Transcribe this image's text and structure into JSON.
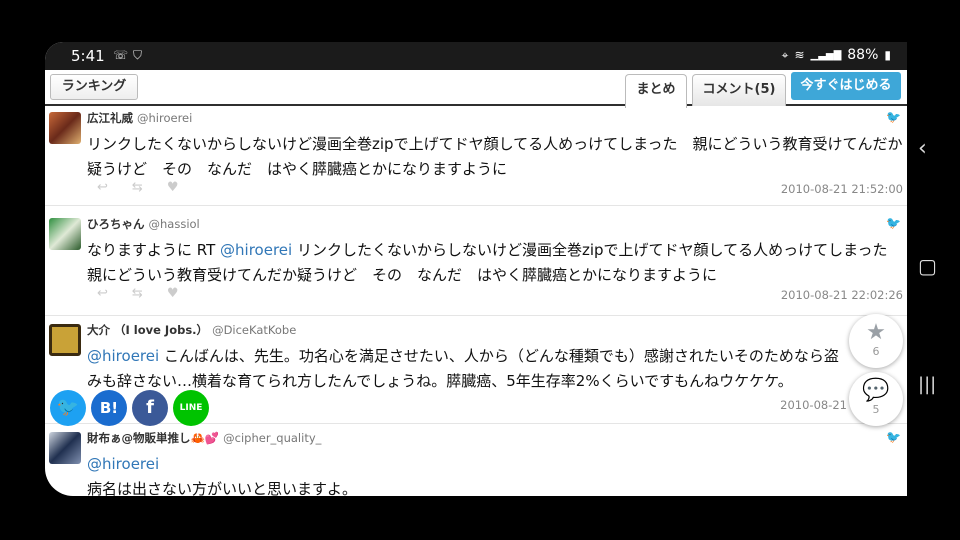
{
  "status": {
    "time": "5:41",
    "battery": "88%"
  },
  "tabs": {
    "ranking": "ランキング",
    "matome": "まとめ",
    "comment": "コメント(5)",
    "start": "今すぐはじめる"
  },
  "tweets": [
    {
      "name": "広江礼威",
      "handle": "@hiroerei",
      "text": "リンクしたくないからしないけど漫画全巻zipで上げてドヤ顔してる人めっけてしまった　親にどういう教育受けてんだか疑うけど　その　なんだ　はやく膵臓癌とかになりますように",
      "date": "2010-08-21 21:52:00"
    },
    {
      "name": "ひろちゃん",
      "handle": "@hassiol",
      "text_prefix": "なりますように RT ",
      "mention": "@hiroerei",
      "text": " リンクしたくないからしないけど漫画全巻zipで上げてドヤ顔してる人めっけてしまった　親にどういう教育受けてんだか疑うけど　その　なんだ　はやく膵臓癌とかになりますように",
      "date": "2010-08-21 22:02:26"
    },
    {
      "name": "大介 （I love Jobs.）",
      "handle": "@DiceKatKobe",
      "mention": "@hiroerei",
      "text": " こんばんは、先生。功名心を満足させたい、人から（どんな種類でも）感謝されたいそのためなら盗みも辞さない…横着な育てられ方したんでしょうね。膵臓癌、5年生存率2%くらいですもんねウケケケ。",
      "date": "2010-08-21"
    },
    {
      "name": "財布ぁ@物販単推し🦀💕",
      "handle": "@cipher_quality_",
      "mention": "@hiroerei",
      "text": "病名は出さない方がいいと思いますよ。"
    }
  ],
  "share": {
    "b": "B!",
    "line": "LINE"
  },
  "fab": {
    "star_count": "6",
    "comment_count": "5"
  },
  "icons": [
    "clock-wifi-icon",
    "shield-icon",
    "location-icon",
    "wifi-icon",
    "signal-icon",
    "battery-icon",
    "twitter-bird-icon",
    "reply-icon",
    "retweet-icon",
    "like-icon",
    "star-icon",
    "comment-icon",
    "back-icon",
    "home-icon",
    "recents-icon"
  ]
}
